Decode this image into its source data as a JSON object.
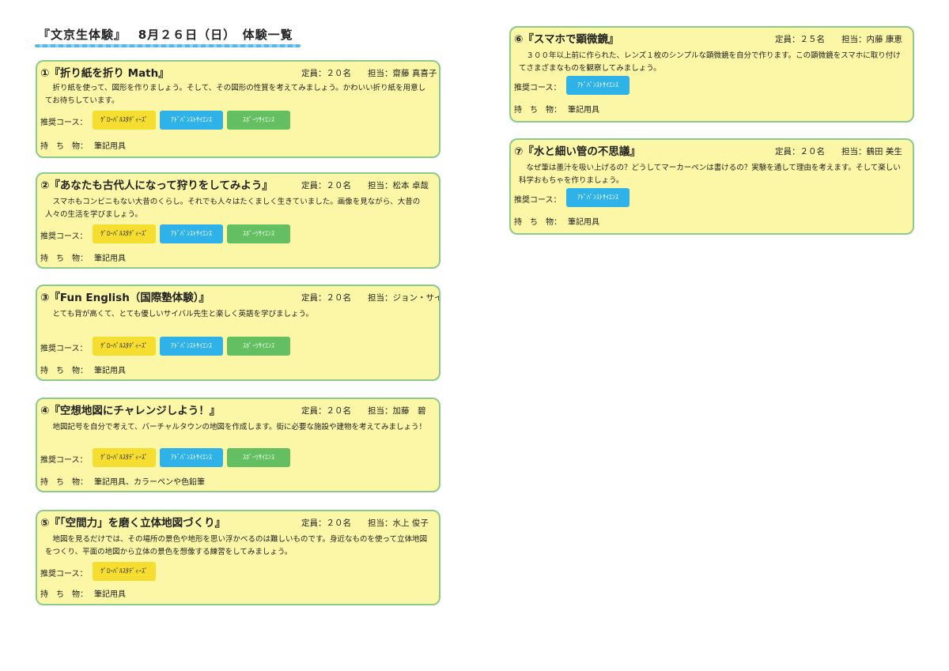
{
  "header": {
    "title": "『文京生体験』　 8月２６日（日）　体験一覧"
  },
  "labels": {
    "course": "推奨コース：",
    "belongings": "持　ち　物："
  },
  "colors": {
    "card_bg": "#fbf7a6",
    "card_border": "#8cc98a",
    "global_tag": "#f6de30",
    "advance_tag": "#2eb2e8",
    "sports_tag": "#64bf62"
  },
  "cards": [
    {
      "title": "①『折り紙を折り Math』",
      "quota": "定員：２０名",
      "teacher": "担当：齋藤 真喜子",
      "description": "折り紙を使って、図形を作りましょう。そして、その図形の性質を考えてみましょう。かわいい折り紙を用意してお待ちしています。",
      "tags": [
        "ｸﾞﾛｰﾊﾞﾙｽﾀﾃﾞｨｰｽﾞ",
        "ｱﾄﾞﾊﾞﾝｽﾄｻｲｴﾝｽ",
        "ｽﾎﾟｰﾂｻｲｴﾝｽ"
      ],
      "belongings": "筆記用具"
    },
    {
      "title": "②『あなたも古代人になって狩りをしてみよう』",
      "quota": "定員：２０名",
      "teacher": "担当：松本 卓哉",
      "description": "スマホもコンビニもない大昔のくらし。それでも人々はたくましく生きていました。画像を見ながら、大昔の人々の生活を学びましょう。",
      "tags": [
        "ｸﾞﾛｰﾊﾞﾙｽﾀﾃﾞｨｰｽﾞ",
        "ｱﾄﾞﾊﾞﾝｽﾄｻｲｴﾝｽ",
        "ｽﾎﾟｰﾂｻｲｴﾝｽ"
      ],
      "belongings": "筆記用具"
    },
    {
      "title": "③『Fun English（国際塾体験）』",
      "quota": "定員：２０名",
      "teacher": "担当：ジョン・サイバル",
      "description": "とても背が高くて、とても優しいサイバル先生と楽しく英語を学びましょう。",
      "tags": [
        "ｸﾞﾛｰﾊﾞﾙｽﾀﾃﾞｨｰｽﾞ",
        "ｱﾄﾞﾊﾞﾝｽﾄｻｲｴﾝｽ",
        "ｽﾎﾟｰﾂｻｲｴﾝｽ"
      ],
      "belongings": "筆記用具"
    },
    {
      "title": "④『空想地図にチャレンジしよう！』",
      "quota": "定員：２０名",
      "teacher": "担当：加藤　碧",
      "description": "地図記号を自分で考えて、バーチャルタウンの地図を作成します。街に必要な施設や建物を考えてみましょう！",
      "tags": [
        "ｸﾞﾛｰﾊﾞﾙｽﾀﾃﾞｨｰｽﾞ",
        "ｱﾄﾞﾊﾞﾝｽﾄｻｲｴﾝｽ",
        "ｽﾎﾟｰﾂｻｲｴﾝｽ"
      ],
      "belongings": "筆記用具、カラーペンや色鉛筆"
    },
    {
      "title": "⑤『「空間力」を磨く立体地図づくり』",
      "quota": "定員：２０名",
      "teacher": "担当：水上 俊子",
      "description": "地図を見るだけでは、その場所の景色や地形を思い浮かべるのは難しいものです。身近なものを使って立体地図をつくり、平面の地図から立体の景色を想像する練習をしてみましょう。",
      "tags": [
        "ｸﾞﾛｰﾊﾞﾙｽﾀﾃﾞｨｰｽﾞ"
      ],
      "belongings": "筆記用具"
    },
    {
      "title": "⑥『スマホで顕微鏡』",
      "quota": "定員：２５名",
      "teacher": "担当：内藤 康恵",
      "description": "３００年以上前に作られた、レンズ１枚のシンプルな顕微鏡を自分で作ります。この顕微鏡をスマホに取り付けてさまざまなものを観察してみましょう。",
      "tags": [
        "ｱﾄﾞﾊﾞﾝｽﾄｻｲｴﾝｽ"
      ],
      "belongings": "筆記用具"
    },
    {
      "title": "⑦『水と細い管の不思議』",
      "quota": "定員：２０名",
      "teacher": "担当：鶴田 美生",
      "description": "なぜ筆は墨汁を吸い上げるの？どうしてマーカーペンは書けるの？実験を通して理由を考えます。そして楽しい科学おもちゃを作りましょう。",
      "tags": [
        "ｱﾄﾞﾊﾞﾝｽﾄｻｲｴﾝｽ"
      ],
      "belongings": "筆記用具"
    }
  ]
}
